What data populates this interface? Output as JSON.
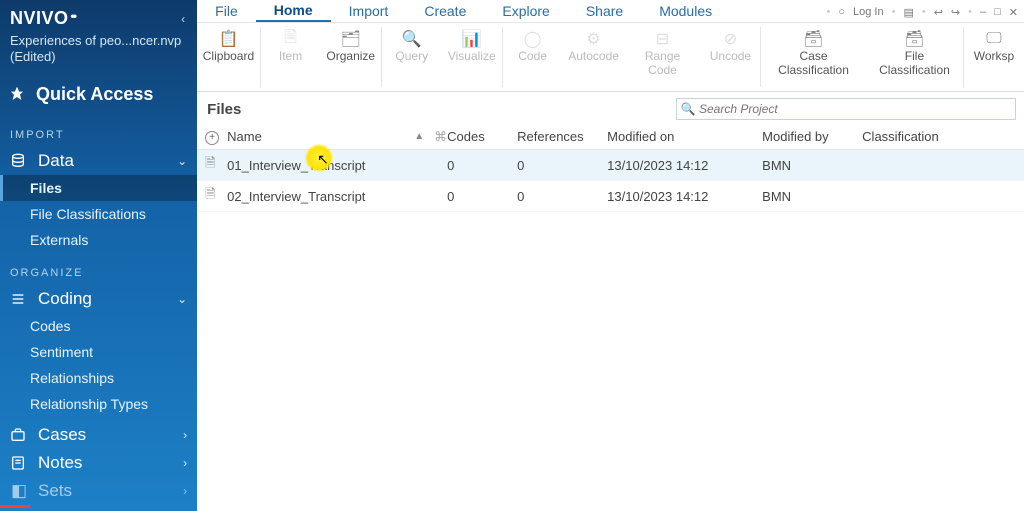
{
  "brand": "NVIVO",
  "project_name": "Experiences of peo...ncer.nvp",
  "project_status": "(Edited)",
  "quick_access": "Quick Access",
  "section_import": "IMPORT",
  "section_organize": "ORGANIZE",
  "groups": {
    "data": "Data",
    "coding": "Coding",
    "cases": "Cases",
    "notes": "Notes",
    "sets": "Sets"
  },
  "data_items": {
    "files": "Files",
    "fileclass": "File Classifications",
    "externals": "Externals"
  },
  "coding_items": {
    "codes": "Codes",
    "sentiment": "Sentiment",
    "relationships": "Relationships",
    "reltypes": "Relationship Types"
  },
  "titlebar": {
    "login": "Log In"
  },
  "tabs": {
    "file": "File",
    "home": "Home",
    "import": "Import",
    "create": "Create",
    "explore": "Explore",
    "share": "Share",
    "modules": "Modules"
  },
  "ribbon": {
    "clipboard": "Clipboard",
    "item": "Item",
    "organize": "Organize",
    "query": "Query",
    "visualize": "Visualize",
    "code": "Code",
    "autocode": "Autocode",
    "rangecode": "Range Code",
    "uncode": "Uncode",
    "caseclass": "Case Classification",
    "fileclass": "File Classification",
    "workspace": "Worksp"
  },
  "panel_title": "Files",
  "search_placeholder": "Search Project",
  "grid": {
    "name": "Name",
    "codes": "Codes",
    "refs": "References",
    "modon": "Modified on",
    "modby": "Modified by",
    "class": "Classification"
  },
  "rows": [
    {
      "name": "01_Interview_Transcript",
      "codes": "0",
      "refs": "0",
      "modon": "13/10/2023 14:12",
      "modby": "BMN",
      "class": ""
    },
    {
      "name": "02_Interview_Transcript",
      "codes": "0",
      "refs": "0",
      "modon": "13/10/2023 14:12",
      "modby": "BMN",
      "class": ""
    }
  ]
}
